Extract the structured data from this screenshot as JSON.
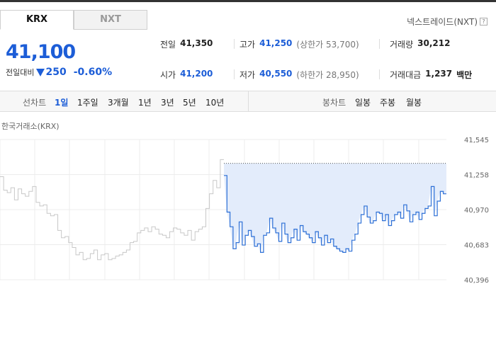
{
  "tabs": [
    {
      "label": "KRX",
      "active": true
    },
    {
      "label": "NXT",
      "active": false
    }
  ],
  "nxt_link": {
    "label": "넥스트레이드(NXT)",
    "help_icon": "?"
  },
  "quote": {
    "price": "41,100",
    "change_label": "전일대비",
    "change_direction": "down",
    "change_value": "250",
    "change_percent": "-0.60%",
    "color": "#1c5dd7"
  },
  "stats": {
    "prev_close": {
      "label": "전일",
      "value": "41,350"
    },
    "high": {
      "label": "고가",
      "value": "41,250",
      "limit_label": "(상한가 53,700)"
    },
    "volume": {
      "label": "거래량",
      "value": "30,212"
    },
    "open": {
      "label": "시가",
      "value": "41,200"
    },
    "low": {
      "label": "저가",
      "value": "40,550",
      "limit_label": "(하한가 28,950)"
    },
    "amount": {
      "label": "거래대금",
      "value": "1,237",
      "unit": "백만"
    }
  },
  "toolbar": {
    "line_label": "선차트",
    "line_periods": [
      "1일",
      "1주일",
      "3개월",
      "1년",
      "3년",
      "5년",
      "10년"
    ],
    "active_period": "1일",
    "candle_label": "봉차트",
    "candle_periods": [
      "일봉",
      "주봉",
      "월봉"
    ]
  },
  "chart_title": "한국거래소(KRX)",
  "chart_data": {
    "type": "line",
    "title": "",
    "y_ticks": [
      "41,545",
      "41,258",
      "40,970",
      "40,683",
      "40,396"
    ],
    "ylim": [
      40396,
      41545
    ],
    "reference_price": 41350,
    "colors": {
      "previous": "#c8c8c8",
      "today": "#2c6fd6",
      "fill": "#e3ecfb",
      "grid": "#ececec"
    },
    "series": [
      {
        "values": [
          41240,
          41130,
          41110,
          41150,
          41050,
          41140,
          41100,
          41080,
          41120,
          41160,
          41030,
          41000,
          41010,
          40940,
          40920,
          40930,
          40800,
          40740,
          40750,
          40700,
          40660,
          40600,
          40620,
          40560,
          40570,
          40610,
          40640,
          40560,
          40600,
          40610,
          40560,
          40570,
          40590,
          40600,
          40620,
          40640,
          40700,
          40710,
          40780,
          40800,
          40820,
          40790,
          40830,
          40810,
          40770,
          40760,
          40740,
          40790,
          40820,
          40810,
          40780,
          40760,
          40800,
          40720,
          40790,
          40810,
          40830,
          40980,
          41100,
          41210,
          41150,
          41380,
          41380
        ]
      },
      {
        "values": [
          41250,
          40950,
          40830,
          40650,
          40700,
          40870,
          40680,
          40760,
          40800,
          40750,
          40670,
          40690,
          40620,
          40760,
          40780,
          40900,
          40820,
          40780,
          40710,
          40860,
          40770,
          40700,
          40740,
          40810,
          40720,
          40840,
          40790,
          40770,
          40740,
          40700,
          40790,
          40740,
          40680,
          40760,
          40700,
          40730,
          40670,
          40650,
          40630,
          40620,
          40650,
          40630,
          40720,
          40770,
          40860,
          40930,
          41000,
          40910,
          40860,
          40880,
          40950,
          40940,
          40880,
          40930,
          40840,
          40880,
          40930,
          40950,
          40900,
          41010,
          40960,
          40870,
          40930,
          40950,
          40890,
          40940,
          40980,
          41000,
          41160,
          40920,
          41040,
          41120,
          41100,
          41100
        ]
      }
    ]
  }
}
